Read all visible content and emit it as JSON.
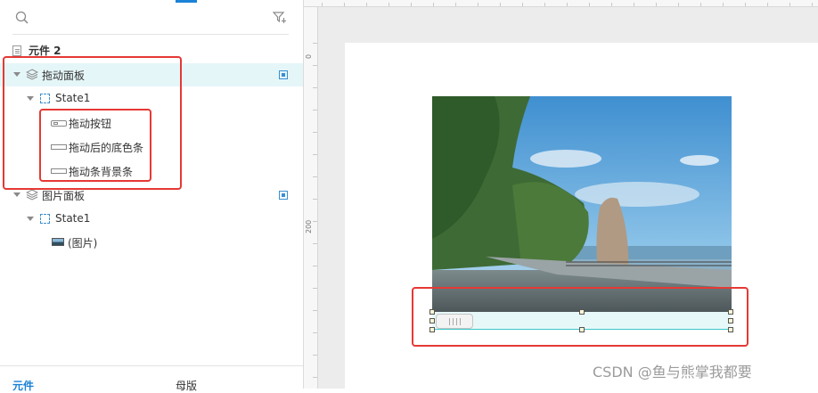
{
  "toolbar": {
    "search_icon": "search-icon",
    "filter_icon": "filter-icon"
  },
  "tree": {
    "title": "元件 2",
    "items": [
      {
        "label": "拖动面板",
        "icon": "layers-icon"
      },
      {
        "label": "State1",
        "icon": "state-icon"
      },
      {
        "label": "拖动按钮",
        "icon": "button-icon"
      },
      {
        "label": "拖动后的底色条",
        "icon": "rectangle-icon"
      },
      {
        "label": "拖动条背景条",
        "icon": "rectangle-icon"
      },
      {
        "label": "图片面板",
        "icon": "layers-icon"
      },
      {
        "label": "State1",
        "icon": "state-icon"
      },
      {
        "label": "(图片)",
        "icon": "image-icon"
      }
    ]
  },
  "bottom_tabs": [
    {
      "label": "元件",
      "active": true
    },
    {
      "label": "母版",
      "active": false
    }
  ],
  "ruler": {
    "v_labels": [
      "0",
      "200"
    ]
  },
  "watermark": "CSDN @鱼与熊掌我都要",
  "colors": {
    "accent": "#1a82d7",
    "highlight": "#e53935",
    "selected_row": "#e5f6f9",
    "slider_fill": "#e7f8f9",
    "slider_line": "#3dc6c9"
  }
}
